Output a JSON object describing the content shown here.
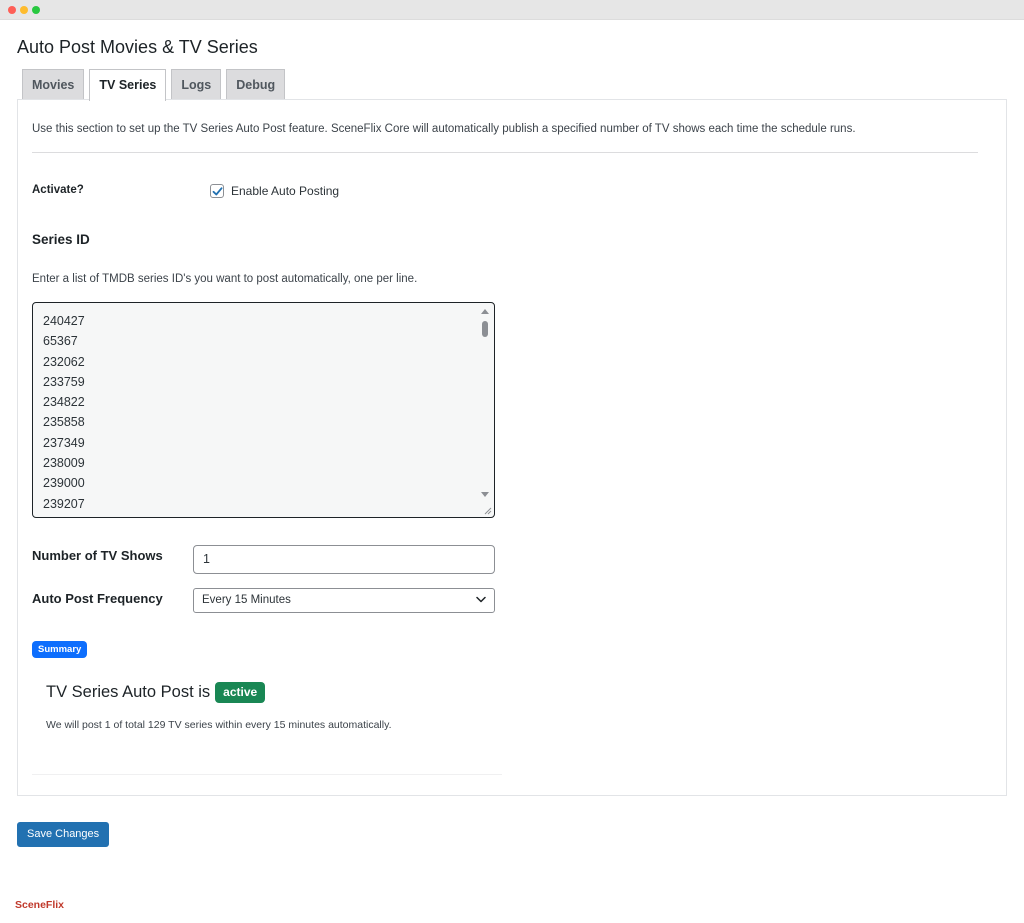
{
  "page": {
    "title": "Auto Post Movies & TV Series"
  },
  "tabs": [
    {
      "label": "Movies",
      "active": false
    },
    {
      "label": "TV Series",
      "active": true
    },
    {
      "label": "Logs",
      "active": false
    },
    {
      "label": "Debug",
      "active": false
    }
  ],
  "section": {
    "intro": "Use this section to set up the TV Series Auto Post feature. SceneFlix Core will automatically publish a specified number of TV shows each time the schedule runs.",
    "activate_label": "Activate?",
    "enable_checkbox_label": "Enable Auto Posting",
    "enable_checked": true,
    "series_heading": "Series ID",
    "series_help": "Enter a list of TMDB series ID's you want to post automatically, one per line.",
    "series_ids": [
      "240427",
      "65367",
      "232062",
      "233759",
      "234822",
      "235858",
      "237349",
      "238009",
      "239000",
      "239207"
    ],
    "tv_shows_label": "Number of TV Shows",
    "tv_shows_value": "1",
    "frequency_label": "Auto Post Frequency",
    "frequency_value": "Every 15 Minutes"
  },
  "summary": {
    "badge": "Summary",
    "status_text": "TV Series Auto Post is",
    "status_badge": "active",
    "description": "We will post 1 of total 129 TV series within every 15 minutes automatically."
  },
  "actions": {
    "save_label": "Save Changes"
  },
  "footer": {
    "logo_text": "SceneFlix"
  },
  "colors": {
    "primary_button": "#2271b1",
    "summary_badge": "#0d6efd",
    "active_badge": "#198754",
    "logo": "#c0392b"
  },
  "icons": {
    "checkbox": "checkmark-icon",
    "select": "chevron-down-icon"
  }
}
